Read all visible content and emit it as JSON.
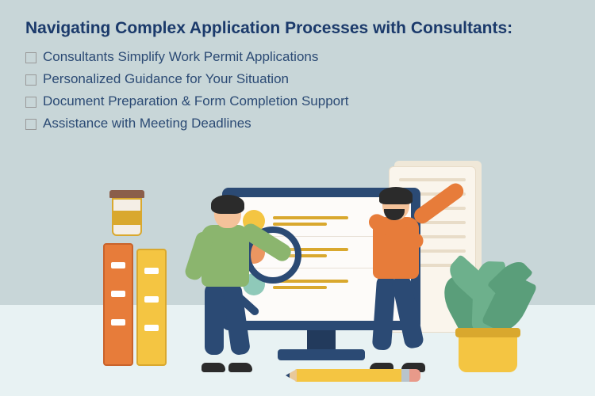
{
  "title": "Navigating Complex Application Processes with Consultants:",
  "bullets": [
    "Consultants Simplify Work Permit Applications",
    "Personalized Guidance for Your Situation",
    "Document Preparation & Form Completion Support",
    "Assistance with Meeting Deadlines"
  ]
}
